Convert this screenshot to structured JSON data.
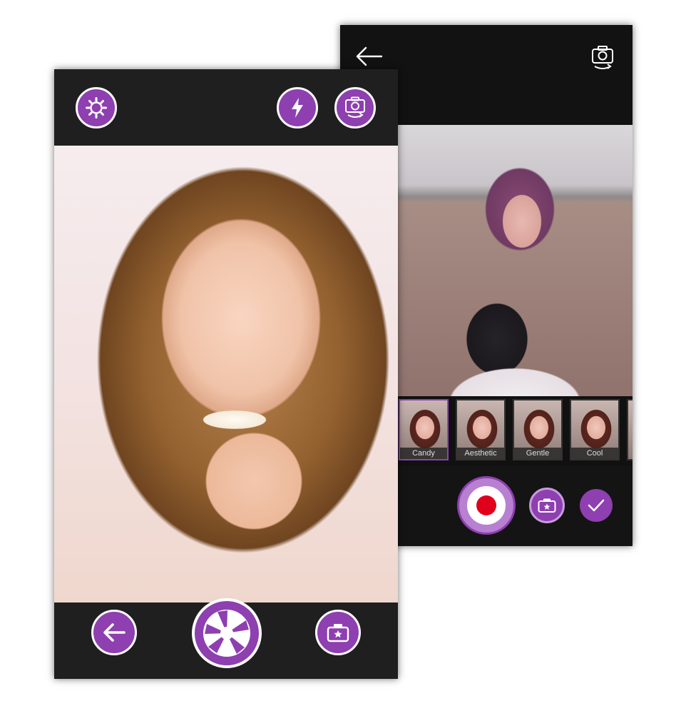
{
  "filter_screen": {
    "filters": [
      {
        "label": "Candy",
        "selected": true
      },
      {
        "label": "Aesthetic",
        "selected": false
      },
      {
        "label": "Gentle",
        "selected": false
      },
      {
        "label": "Cool",
        "selected": false
      }
    ],
    "icons": {
      "back": "arrow-left-icon",
      "switch_camera": "switch-camera-icon",
      "record": "record-icon",
      "sticker_camera": "camera-star-icon",
      "confirm": "checkmark-icon"
    }
  },
  "camera_screen": {
    "icons": {
      "settings": "gear-icon",
      "flash": "flash-icon",
      "switch_camera": "switch-camera-icon",
      "back": "arrow-left-icon",
      "shutter": "aperture-icon",
      "sticker_camera": "camera-star-icon"
    }
  },
  "colors": {
    "accent": "#8e3fb0",
    "bar_background": "#1f1f1f",
    "record_red": "#e0001b"
  }
}
